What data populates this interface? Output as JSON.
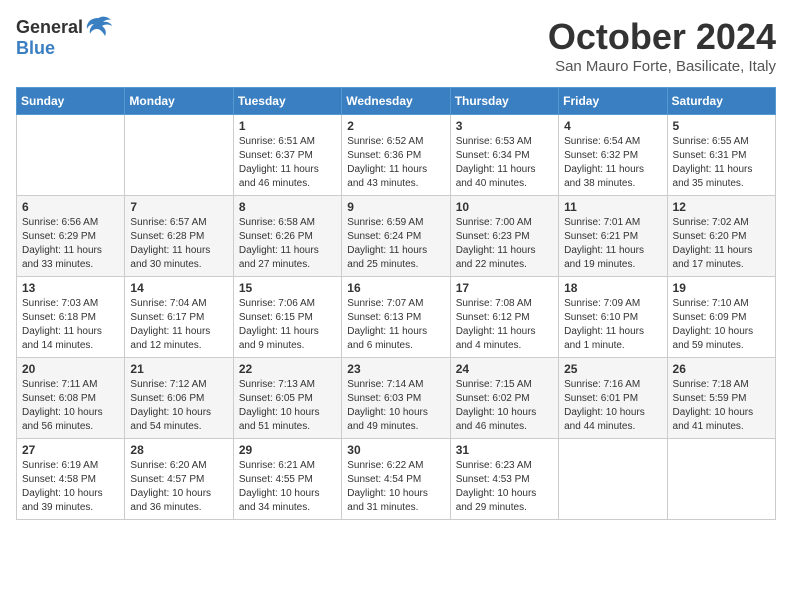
{
  "header": {
    "logo_general": "General",
    "logo_blue": "Blue",
    "month_title": "October 2024",
    "subtitle": "San Mauro Forte, Basilicate, Italy"
  },
  "days_of_week": [
    "Sunday",
    "Monday",
    "Tuesday",
    "Wednesday",
    "Thursday",
    "Friday",
    "Saturday"
  ],
  "weeks": [
    [
      {
        "day": null,
        "info": null
      },
      {
        "day": null,
        "info": null
      },
      {
        "day": "1",
        "info": "Sunrise: 6:51 AM\nSunset: 6:37 PM\nDaylight: 11 hours and 46 minutes."
      },
      {
        "day": "2",
        "info": "Sunrise: 6:52 AM\nSunset: 6:36 PM\nDaylight: 11 hours and 43 minutes."
      },
      {
        "day": "3",
        "info": "Sunrise: 6:53 AM\nSunset: 6:34 PM\nDaylight: 11 hours and 40 minutes."
      },
      {
        "day": "4",
        "info": "Sunrise: 6:54 AM\nSunset: 6:32 PM\nDaylight: 11 hours and 38 minutes."
      },
      {
        "day": "5",
        "info": "Sunrise: 6:55 AM\nSunset: 6:31 PM\nDaylight: 11 hours and 35 minutes."
      }
    ],
    [
      {
        "day": "6",
        "info": "Sunrise: 6:56 AM\nSunset: 6:29 PM\nDaylight: 11 hours and 33 minutes."
      },
      {
        "day": "7",
        "info": "Sunrise: 6:57 AM\nSunset: 6:28 PM\nDaylight: 11 hours and 30 minutes."
      },
      {
        "day": "8",
        "info": "Sunrise: 6:58 AM\nSunset: 6:26 PM\nDaylight: 11 hours and 27 minutes."
      },
      {
        "day": "9",
        "info": "Sunrise: 6:59 AM\nSunset: 6:24 PM\nDaylight: 11 hours and 25 minutes."
      },
      {
        "day": "10",
        "info": "Sunrise: 7:00 AM\nSunset: 6:23 PM\nDaylight: 11 hours and 22 minutes."
      },
      {
        "day": "11",
        "info": "Sunrise: 7:01 AM\nSunset: 6:21 PM\nDaylight: 11 hours and 19 minutes."
      },
      {
        "day": "12",
        "info": "Sunrise: 7:02 AM\nSunset: 6:20 PM\nDaylight: 11 hours and 17 minutes."
      }
    ],
    [
      {
        "day": "13",
        "info": "Sunrise: 7:03 AM\nSunset: 6:18 PM\nDaylight: 11 hours and 14 minutes."
      },
      {
        "day": "14",
        "info": "Sunrise: 7:04 AM\nSunset: 6:17 PM\nDaylight: 11 hours and 12 minutes."
      },
      {
        "day": "15",
        "info": "Sunrise: 7:06 AM\nSunset: 6:15 PM\nDaylight: 11 hours and 9 minutes."
      },
      {
        "day": "16",
        "info": "Sunrise: 7:07 AM\nSunset: 6:13 PM\nDaylight: 11 hours and 6 minutes."
      },
      {
        "day": "17",
        "info": "Sunrise: 7:08 AM\nSunset: 6:12 PM\nDaylight: 11 hours and 4 minutes."
      },
      {
        "day": "18",
        "info": "Sunrise: 7:09 AM\nSunset: 6:10 PM\nDaylight: 11 hours and 1 minute."
      },
      {
        "day": "19",
        "info": "Sunrise: 7:10 AM\nSunset: 6:09 PM\nDaylight: 10 hours and 59 minutes."
      }
    ],
    [
      {
        "day": "20",
        "info": "Sunrise: 7:11 AM\nSunset: 6:08 PM\nDaylight: 10 hours and 56 minutes."
      },
      {
        "day": "21",
        "info": "Sunrise: 7:12 AM\nSunset: 6:06 PM\nDaylight: 10 hours and 54 minutes."
      },
      {
        "day": "22",
        "info": "Sunrise: 7:13 AM\nSunset: 6:05 PM\nDaylight: 10 hours and 51 minutes."
      },
      {
        "day": "23",
        "info": "Sunrise: 7:14 AM\nSunset: 6:03 PM\nDaylight: 10 hours and 49 minutes."
      },
      {
        "day": "24",
        "info": "Sunrise: 7:15 AM\nSunset: 6:02 PM\nDaylight: 10 hours and 46 minutes."
      },
      {
        "day": "25",
        "info": "Sunrise: 7:16 AM\nSunset: 6:01 PM\nDaylight: 10 hours and 44 minutes."
      },
      {
        "day": "26",
        "info": "Sunrise: 7:18 AM\nSunset: 5:59 PM\nDaylight: 10 hours and 41 minutes."
      }
    ],
    [
      {
        "day": "27",
        "info": "Sunrise: 6:19 AM\nSunset: 4:58 PM\nDaylight: 10 hours and 39 minutes."
      },
      {
        "day": "28",
        "info": "Sunrise: 6:20 AM\nSunset: 4:57 PM\nDaylight: 10 hours and 36 minutes."
      },
      {
        "day": "29",
        "info": "Sunrise: 6:21 AM\nSunset: 4:55 PM\nDaylight: 10 hours and 34 minutes."
      },
      {
        "day": "30",
        "info": "Sunrise: 6:22 AM\nSunset: 4:54 PM\nDaylight: 10 hours and 31 minutes."
      },
      {
        "day": "31",
        "info": "Sunrise: 6:23 AM\nSunset: 4:53 PM\nDaylight: 10 hours and 29 minutes."
      },
      {
        "day": null,
        "info": null
      },
      {
        "day": null,
        "info": null
      }
    ]
  ]
}
